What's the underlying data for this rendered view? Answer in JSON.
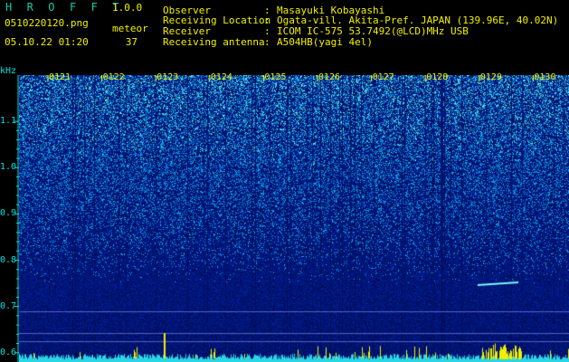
{
  "header": {
    "app_title": "H R O F F T",
    "version": "1.0.0",
    "file_name": "0510220120.png",
    "datetime": "05.10.22 01:20",
    "meteor_label": "meteor",
    "meteor_count": "37",
    "info": [
      {
        "label": "Observer",
        "sep": ":",
        "value": "Masayuki Kobayashi"
      },
      {
        "label": "Receiving Location",
        "sep": ":",
        "value": "Ogata-vill. Akita-Pref. JAPAN (139.96E, 40.02N)"
      },
      {
        "label": "Receiver",
        "sep": ":",
        "value": "ICOM IC-575 53.7492(@LCD)MHz USB"
      },
      {
        "label": "Receiving antenna",
        "sep": ":",
        "value": "A504HB(yagi 4el)"
      }
    ]
  },
  "spectrogram": {
    "y_unit": "kHz",
    "y_ticks": [
      "1.1",
      "1.0",
      "0.9",
      "0.8",
      "0.7",
      "0.6"
    ],
    "y_range_khz": [
      0.58,
      1.2
    ],
    "time_labels": [
      "0121",
      "0122",
      "0123",
      "0124",
      "0125",
      "0126",
      "0127",
      "0128",
      "0129",
      "0130"
    ],
    "colors": {
      "text_yellow": "#f0f000",
      "axis_cyan": "#00e0e0",
      "background_blue": "#0a1f9e",
      "noise_cyan": "#2ad6e6",
      "meteor_trail": "#7df5ff"
    }
  }
}
